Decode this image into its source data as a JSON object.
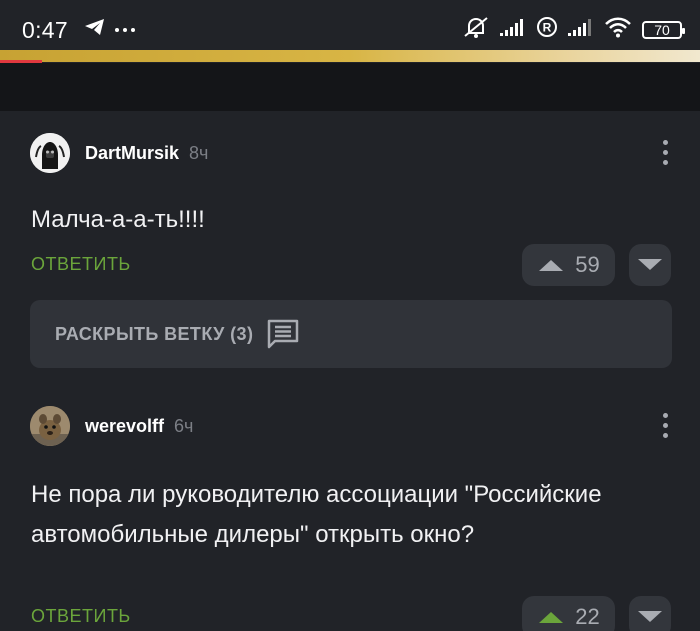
{
  "status_bar": {
    "time": "0:47",
    "battery": "70",
    "icons": [
      "telegram-icon",
      "more-dots-icon",
      "bell-off-icon",
      "signal-icon",
      "registered-icon",
      "signal-icon-2",
      "wifi-icon",
      "battery-icon"
    ]
  },
  "comments": [
    {
      "username": "DartMursik",
      "time": "8ч",
      "text": "Малча-а-а-ть!!!!",
      "reply_label": "ОТВЕТИТЬ",
      "upvotes": "59",
      "avatar": "avatar-dartmursik"
    },
    {
      "username": "werevolff",
      "time": "6ч",
      "text": "Не пора ли руководителю ассоциации \"Российские автомобильные дилеры\" открыть окно?",
      "reply_label": "ОТВЕТИТЬ",
      "upvotes": "22",
      "avatar": "avatar-werevolff"
    }
  ],
  "expand_thread": {
    "label": "РАСКРЫТЬ ВЕТКУ (3)",
    "icon": "comment-icon"
  },
  "colors": {
    "background": "#212328",
    "reply_green": "#6ba53b",
    "button_bg": "#33363c",
    "muted_text": "#a9acb2"
  }
}
